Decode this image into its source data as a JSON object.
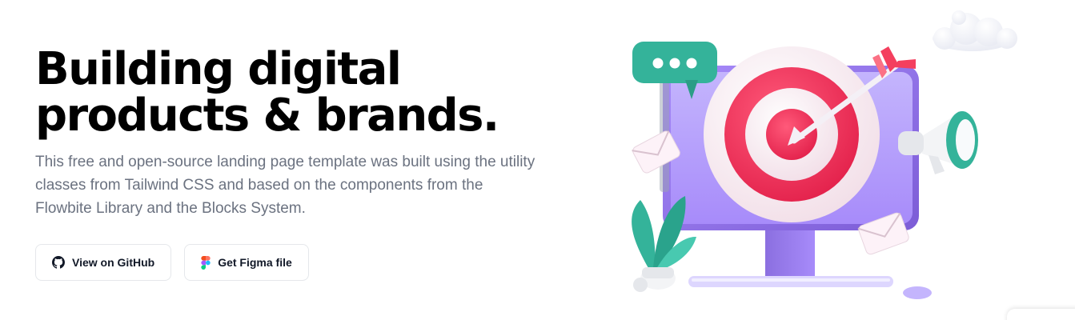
{
  "hero": {
    "title_line1": "Building digital",
    "title_line2": "products & brands.",
    "description": "This free and open-source landing page template was built using the utility classes from Tailwind CSS and based on the components from the Flowbite Library and the Blocks System."
  },
  "buttons": {
    "github_label": "View on GitHub",
    "figma_label": "Get Figma file"
  },
  "icons": {
    "github": "github-icon",
    "figma": "figma-icon",
    "illustration": "target-monitor-illustration"
  },
  "colors": {
    "monitor": "#a78bfa",
    "target_red": "#f43f5e",
    "chat_teal": "#34b39a",
    "text_muted": "#6b7280"
  }
}
